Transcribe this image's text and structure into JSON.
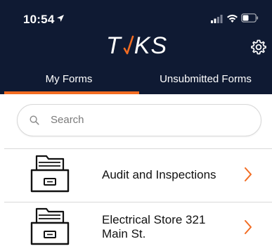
{
  "status_bar": {
    "time": "10:54"
  },
  "header": {
    "logo_text_left": "T",
    "logo_text_right": "KS"
  },
  "tabs": [
    {
      "label": "My Forms",
      "active": true
    },
    {
      "label": "Unsubmitted Forms",
      "active": false
    }
  ],
  "search": {
    "placeholder": "Search"
  },
  "forms": [
    {
      "label": "Audit and Inspections"
    },
    {
      "label_lines": [
        "Electrical Store 321",
        "Main St."
      ]
    }
  ],
  "colors": {
    "header_bg": "#0f1a33",
    "accent": "#f26c22",
    "text": "#111111"
  }
}
